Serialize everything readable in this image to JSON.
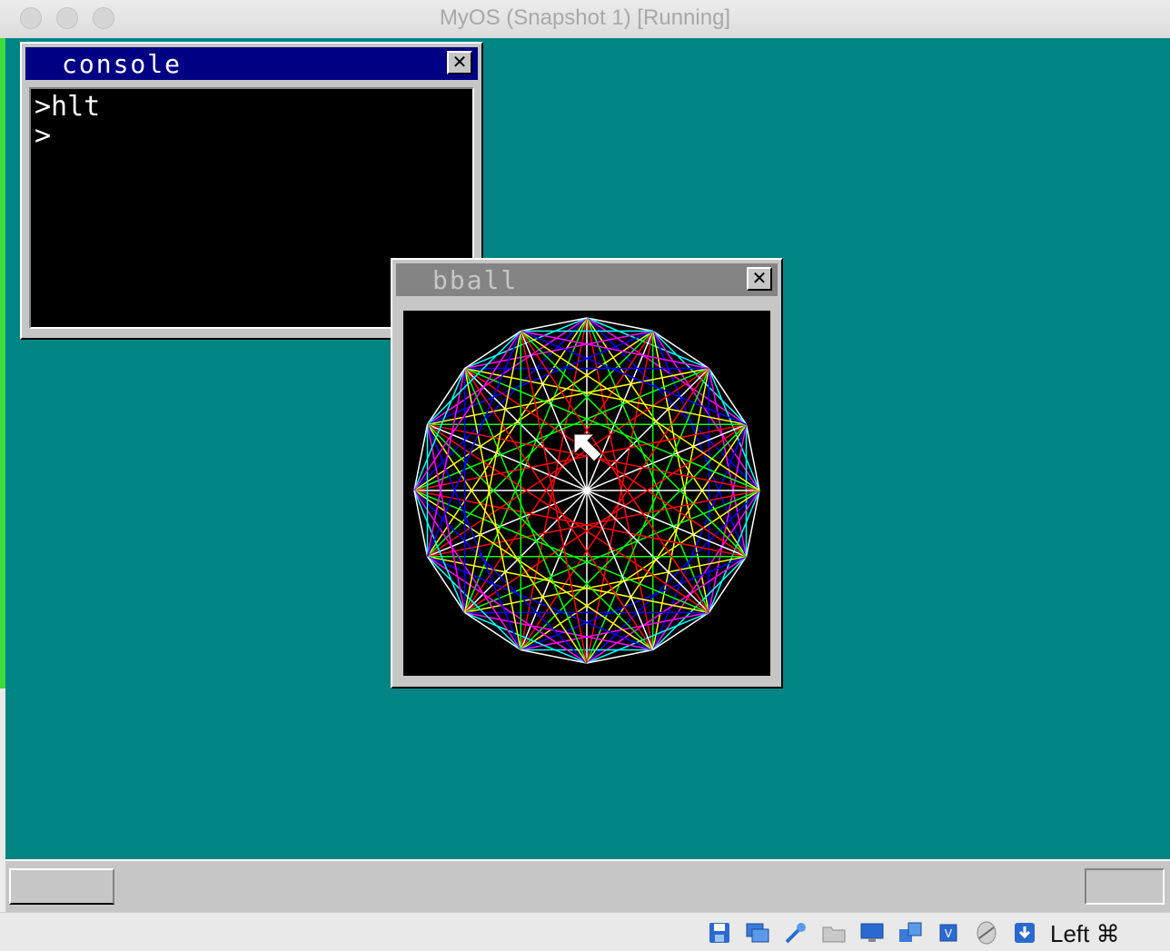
{
  "window": {
    "title": "MyOS (Snapshot 1) [Running]"
  },
  "guest": {
    "desktop_color": "#008484",
    "console": {
      "title": "console",
      "close_label": "✕",
      "lines": [
        ">hlt",
        ">"
      ]
    },
    "bball": {
      "title": "bball",
      "close_label": "✕",
      "line_colors": [
        "#ffffff",
        "#00ffff",
        "#ff00ff",
        "#0000ff",
        "#ffff00",
        "#00ff00",
        "#ff0000"
      ]
    }
  },
  "statusbar": {
    "icons": [
      "hard-disk-icon",
      "optical-drive-icon",
      "usb-icon",
      "shared-folder-icon",
      "display-icon",
      "network-icon",
      "cpu-icon",
      "mouse-integration-icon",
      "keyboard-capture-icon"
    ],
    "host_key": "Left ⌘"
  }
}
